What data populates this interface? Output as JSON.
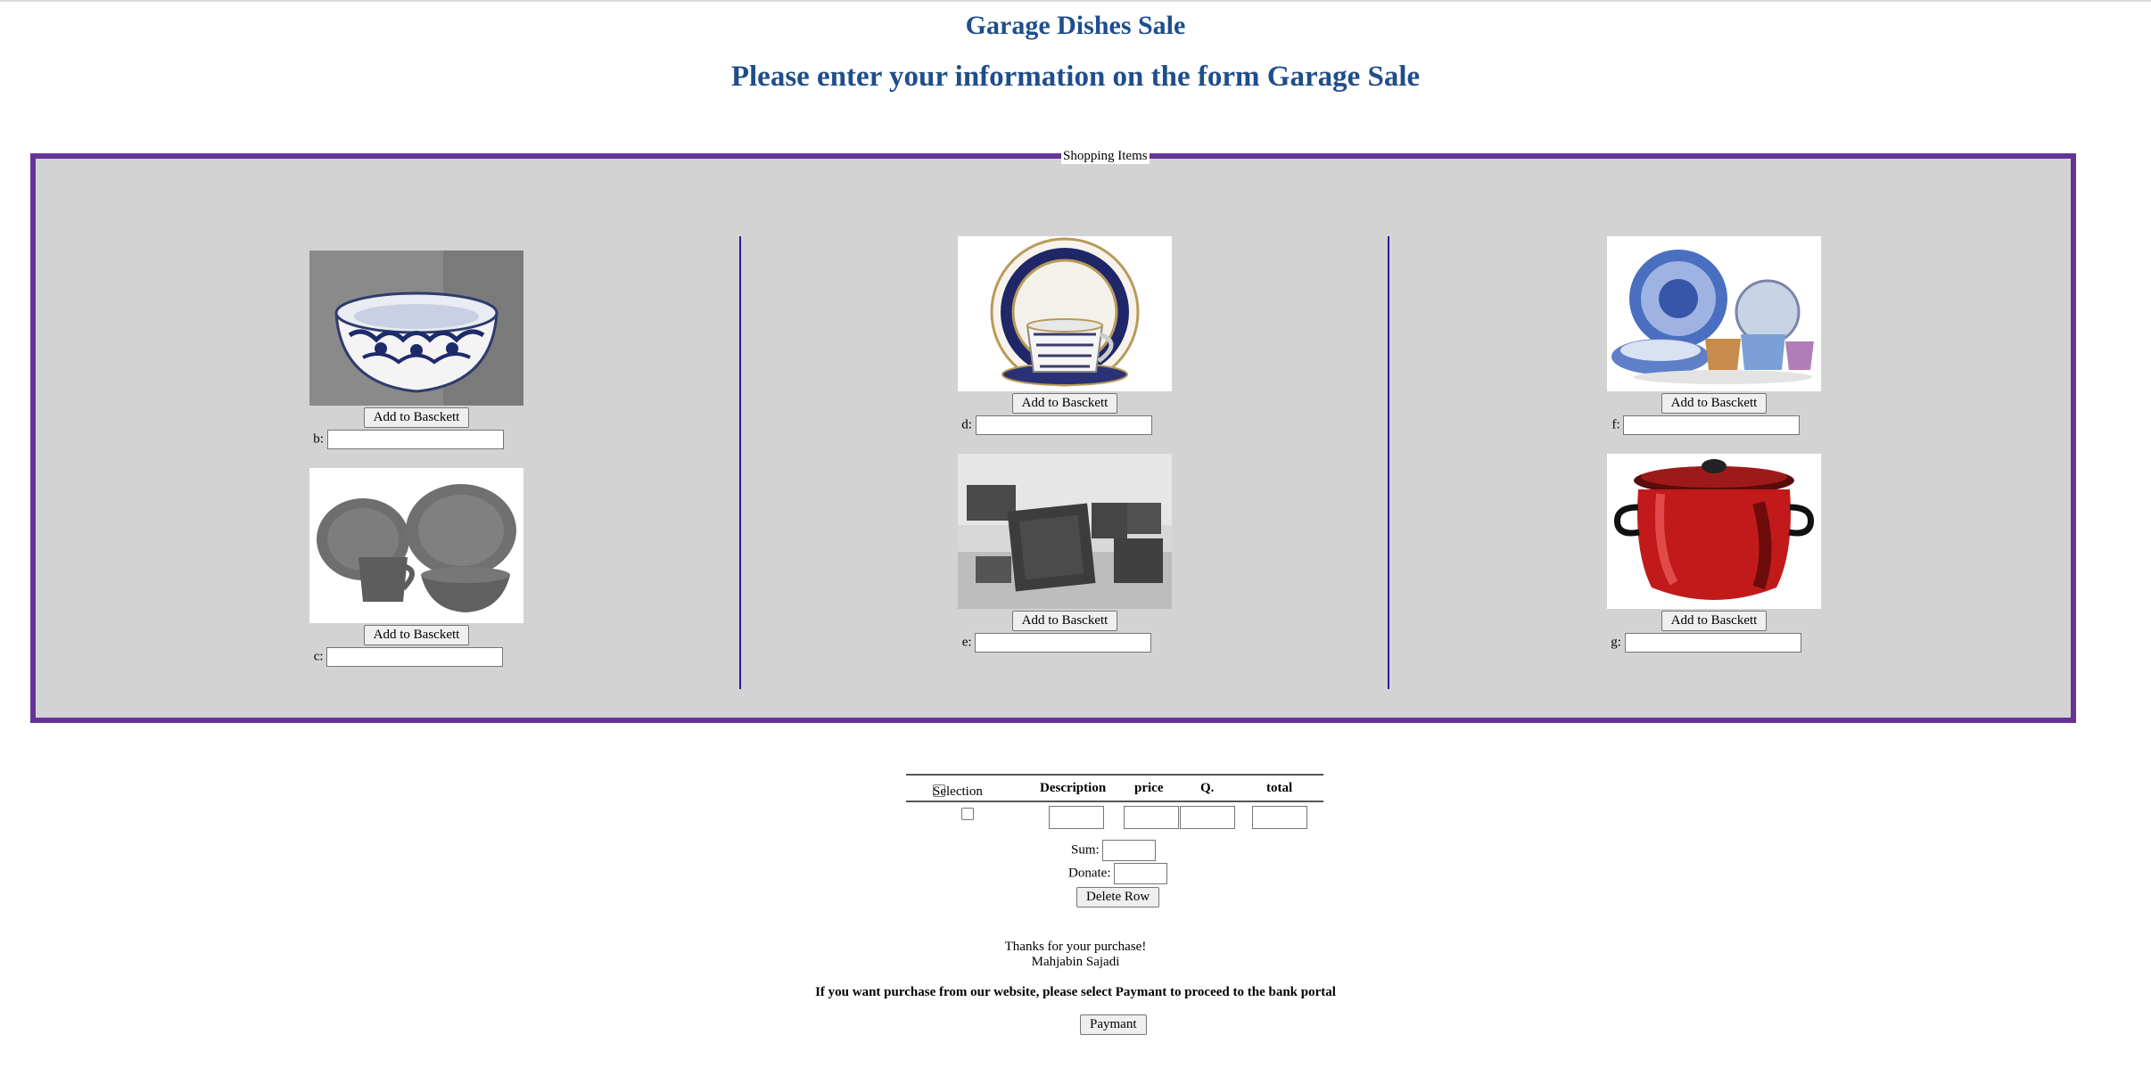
{
  "header": {
    "title": "Garage Dishes Sale",
    "subtitle": "Please enter your information on the form Garage Sale"
  },
  "shopping": {
    "legend": "Shopping Items",
    "add_label": "Add to Basckett",
    "items": [
      {
        "label": "b:",
        "image": "blue-white-bowl",
        "value": ""
      },
      {
        "label": "c:",
        "image": "grey-dinnerware-set",
        "value": ""
      },
      {
        "label": "d:",
        "image": "navy-gold-plate-cup-set",
        "value": ""
      },
      {
        "label": "e:",
        "image": "dark-grey-square-dishes",
        "value": ""
      },
      {
        "label": "f:",
        "image": "blue-patterned-dinnerware",
        "value": ""
      },
      {
        "label": "g:",
        "image": "red-stockpot",
        "value": ""
      }
    ]
  },
  "cart": {
    "headers": {
      "selection": "Selection",
      "description": "Description",
      "price": "price",
      "quantity": "Q.",
      "total": "total"
    },
    "sum_label": "Sum:",
    "donate_label": "Donate:",
    "delete_label": "Delete Row"
  },
  "footer": {
    "thanks": "Thanks for your purchase!",
    "author": "Mahjabin Sajadi",
    "instruction": "If you want purchase from our website, please select Paymant to proceed to the bank portal",
    "payment_label": "Paymant"
  },
  "colors": {
    "title": "#1f4e8c",
    "fieldset_border": "#663399",
    "fieldset_bg": "#d3d3d3",
    "divider": "#2a1a9a"
  }
}
